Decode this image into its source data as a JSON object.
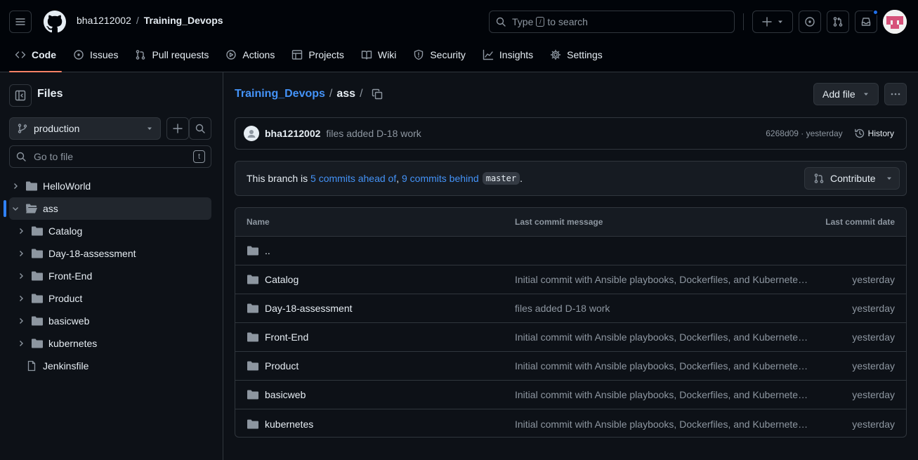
{
  "header": {
    "owner": "bha1212002",
    "separator": "/",
    "repo": "Training_Devops",
    "search_placeholder": "Type",
    "search_placeholder_rest": "to search",
    "search_key": "/"
  },
  "tabs": [
    {
      "label": "Code",
      "icon": "code-icon"
    },
    {
      "label": "Issues",
      "icon": "issue-icon"
    },
    {
      "label": "Pull requests",
      "icon": "pull-request-icon"
    },
    {
      "label": "Actions",
      "icon": "play-icon"
    },
    {
      "label": "Projects",
      "icon": "table-icon"
    },
    {
      "label": "Wiki",
      "icon": "book-icon"
    },
    {
      "label": "Security",
      "icon": "shield-icon"
    },
    {
      "label": "Insights",
      "icon": "graph-icon"
    },
    {
      "label": "Settings",
      "icon": "gear-icon"
    }
  ],
  "sidebar": {
    "title": "Files",
    "branch": "production",
    "goto_placeholder": "Go to file",
    "goto_key": "t",
    "tree": [
      {
        "label": "HelloWorld",
        "type": "folder",
        "depth": 0,
        "expanded": false
      },
      {
        "label": "ass",
        "type": "folder",
        "depth": 0,
        "expanded": true,
        "selected": true
      },
      {
        "label": "Catalog",
        "type": "folder",
        "depth": 1,
        "expanded": false
      },
      {
        "label": "Day-18-assessment",
        "type": "folder",
        "depth": 1,
        "expanded": false
      },
      {
        "label": "Front-End",
        "type": "folder",
        "depth": 1,
        "expanded": false
      },
      {
        "label": "Product",
        "type": "folder",
        "depth": 1,
        "expanded": false
      },
      {
        "label": "basicweb",
        "type": "folder",
        "depth": 1,
        "expanded": false
      },
      {
        "label": "kubernetes",
        "type": "folder",
        "depth": 1,
        "expanded": false
      },
      {
        "label": "Jenkinsfile",
        "type": "file",
        "depth": 0
      }
    ]
  },
  "main": {
    "breadcrumb_repo": "Training_Devops",
    "breadcrumb_sep": "/",
    "breadcrumb_dir": "ass",
    "add_file_label": "Add file",
    "commit": {
      "author": "bha1212002",
      "message": "files added D-18 work",
      "meta": "6268d09 · yesterday",
      "history_label": "History"
    },
    "branch_status": {
      "prefix": "This branch is ",
      "ahead": "5 commits ahead of",
      "comma": ", ",
      "behind": "9 commits behind",
      "base": "master",
      "suffix": ".",
      "contribute_label": "Contribute"
    },
    "table": {
      "headers": [
        "Name",
        "Last commit message",
        "Last commit date"
      ],
      "parent": "..",
      "rows": [
        {
          "name": "Catalog",
          "message": "Initial commit with Ansible playbooks, Dockerfiles, and Kubernetes manifests",
          "date": "yesterday"
        },
        {
          "name": "Day-18-assessment",
          "message": "files added D-18 work",
          "date": "yesterday"
        },
        {
          "name": "Front-End",
          "message": "Initial commit with Ansible playbooks, Dockerfiles, and Kubernetes manifests",
          "date": "yesterday"
        },
        {
          "name": "Product",
          "message": "Initial commit with Ansible playbooks, Dockerfiles, and Kubernetes manifests",
          "date": "yesterday"
        },
        {
          "name": "basicweb",
          "message": "Initial commit with Ansible playbooks, Dockerfiles, and Kubernetes manifests",
          "date": "yesterday"
        },
        {
          "name": "kubernetes",
          "message": "Initial commit with Ansible playbooks, Dockerfiles, and Kubernetes manifests",
          "date": "yesterday"
        }
      ]
    }
  },
  "colors": {
    "accent": "#4493f8",
    "active_tab": "#f78166",
    "notification": "#1f6feb"
  }
}
